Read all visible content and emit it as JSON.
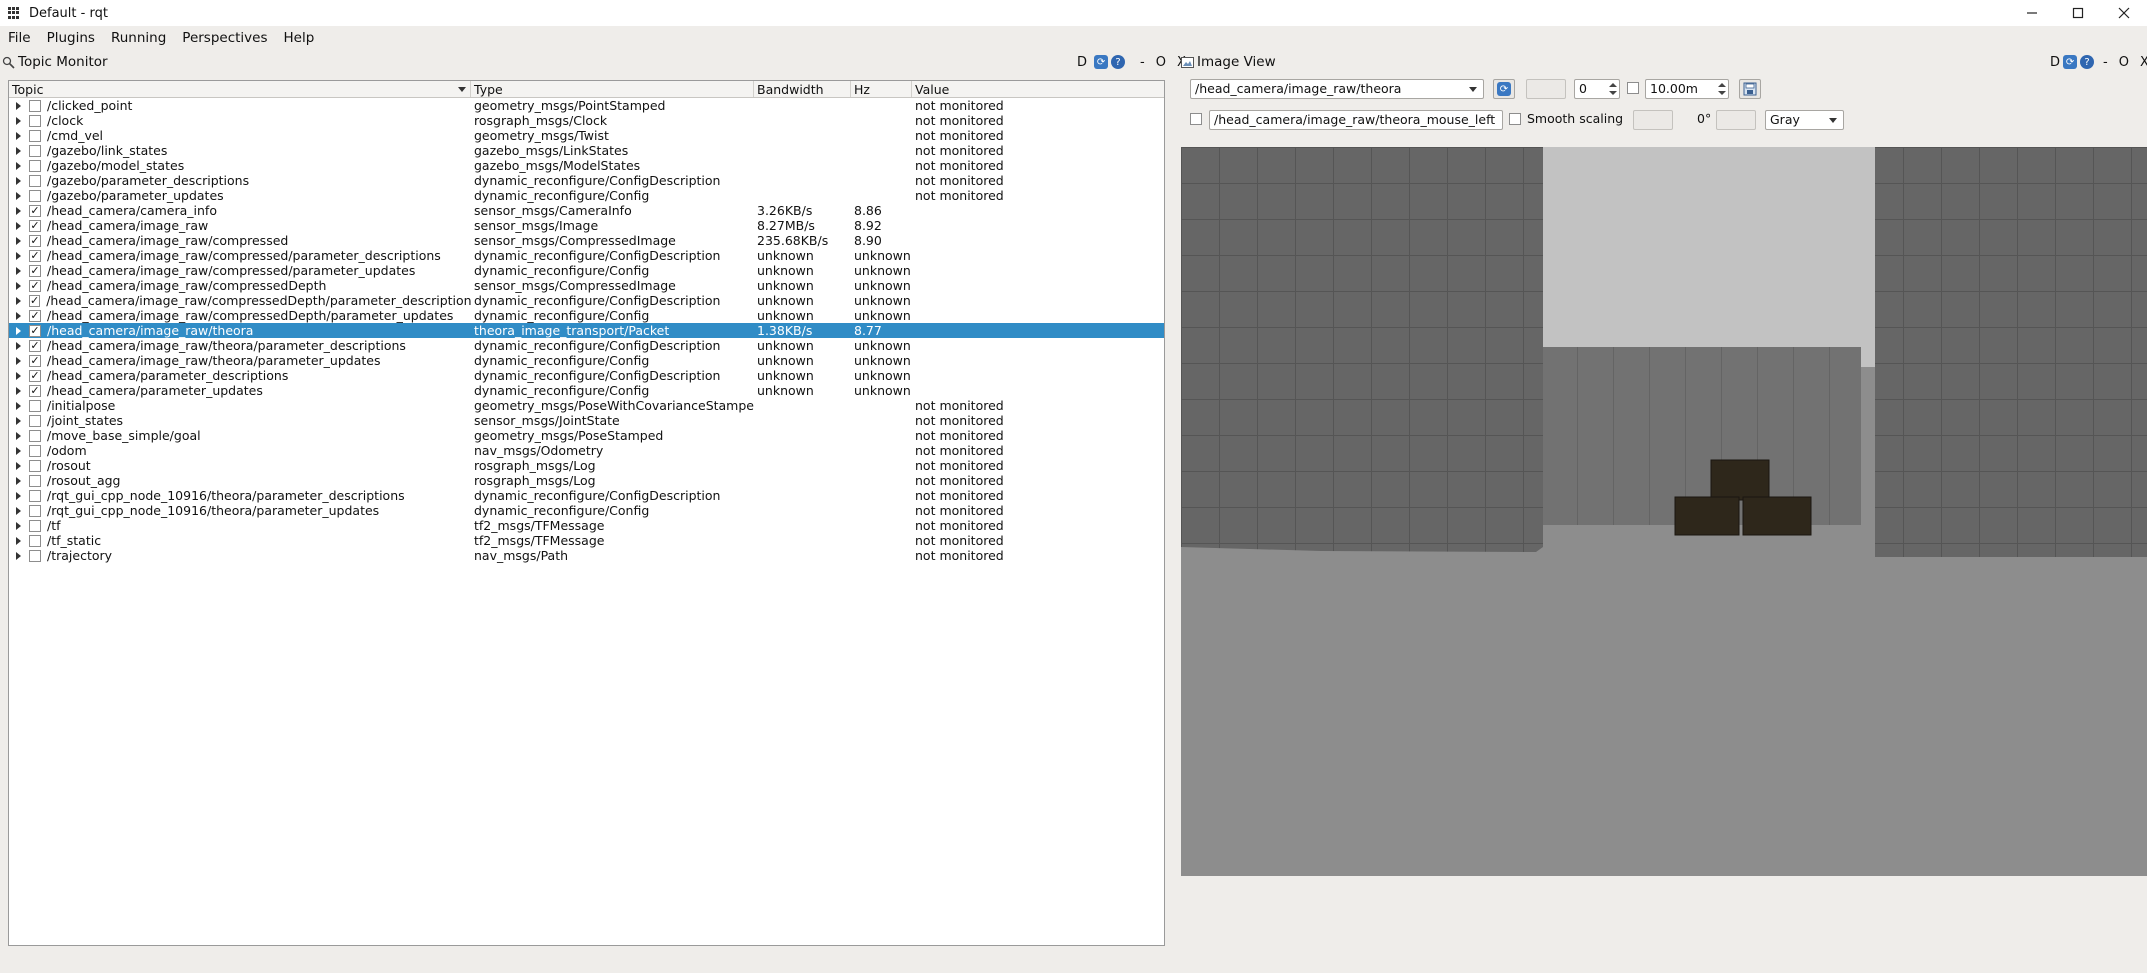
{
  "window": {
    "title": "Default - rqt"
  },
  "menu": [
    "File",
    "Plugins",
    "Running",
    "Perspectives",
    "Help"
  ],
  "topic_monitor": {
    "title": "Topic Monitor",
    "dock_buttons": [
      "D",
      "-",
      "O",
      "X"
    ],
    "columns": [
      "Topic",
      "Type",
      "Bandwidth",
      "Hz",
      "Value"
    ],
    "rows": [
      {
        "topic": "/clicked_point",
        "type": "geometry_msgs/PointStamped",
        "bw": "",
        "hz": "",
        "value": "not monitored",
        "checked": false
      },
      {
        "topic": "/clock",
        "type": "rosgraph_msgs/Clock",
        "bw": "",
        "hz": "",
        "value": "not monitored",
        "checked": false
      },
      {
        "topic": "/cmd_vel",
        "type": "geometry_msgs/Twist",
        "bw": "",
        "hz": "",
        "value": "not monitored",
        "checked": false
      },
      {
        "topic": "/gazebo/link_states",
        "type": "gazebo_msgs/LinkStates",
        "bw": "",
        "hz": "",
        "value": "not monitored",
        "checked": false
      },
      {
        "topic": "/gazebo/model_states",
        "type": "gazebo_msgs/ModelStates",
        "bw": "",
        "hz": "",
        "value": "not monitored",
        "checked": false
      },
      {
        "topic": "/gazebo/parameter_descriptions",
        "type": "dynamic_reconfigure/ConfigDescription",
        "bw": "",
        "hz": "",
        "value": "not monitored",
        "checked": false
      },
      {
        "topic": "/gazebo/parameter_updates",
        "type": "dynamic_reconfigure/Config",
        "bw": "",
        "hz": "",
        "value": "not monitored",
        "checked": false
      },
      {
        "topic": "/head_camera/camera_info",
        "type": "sensor_msgs/CameraInfo",
        "bw": "3.26KB/s",
        "hz": "8.86",
        "value": "",
        "checked": true
      },
      {
        "topic": "/head_camera/image_raw",
        "type": "sensor_msgs/Image",
        "bw": "8.27MB/s",
        "hz": "8.92",
        "value": "",
        "checked": true
      },
      {
        "topic": "/head_camera/image_raw/compressed",
        "type": "sensor_msgs/CompressedImage",
        "bw": "235.68KB/s",
        "hz": "8.90",
        "value": "",
        "checked": true
      },
      {
        "topic": "/head_camera/image_raw/compressed/parameter_descriptions",
        "type": "dynamic_reconfigure/ConfigDescription",
        "bw": "unknown",
        "hz": "unknown",
        "value": "",
        "checked": true
      },
      {
        "topic": "/head_camera/image_raw/compressed/parameter_updates",
        "type": "dynamic_reconfigure/Config",
        "bw": "unknown",
        "hz": "unknown",
        "value": "",
        "checked": true
      },
      {
        "topic": "/head_camera/image_raw/compressedDepth",
        "type": "sensor_msgs/CompressedImage",
        "bw": "unknown",
        "hz": "unknown",
        "value": "",
        "checked": true
      },
      {
        "topic": "/head_camera/image_raw/compressedDepth/parameter_descriptions",
        "type": "dynamic_reconfigure/ConfigDescription",
        "bw": "unknown",
        "hz": "unknown",
        "value": "",
        "checked": true
      },
      {
        "topic": "/head_camera/image_raw/compressedDepth/parameter_updates",
        "type": "dynamic_reconfigure/Config",
        "bw": "unknown",
        "hz": "unknown",
        "value": "",
        "checked": true
      },
      {
        "topic": "/head_camera/image_raw/theora",
        "type": "theora_image_transport/Packet",
        "bw": "1.38KB/s",
        "hz": "8.77",
        "value": "",
        "checked": true,
        "selected": true
      },
      {
        "topic": "/head_camera/image_raw/theora/parameter_descriptions",
        "type": "dynamic_reconfigure/ConfigDescription",
        "bw": "unknown",
        "hz": "unknown",
        "value": "",
        "checked": true
      },
      {
        "topic": "/head_camera/image_raw/theora/parameter_updates",
        "type": "dynamic_reconfigure/Config",
        "bw": "unknown",
        "hz": "unknown",
        "value": "",
        "checked": true
      },
      {
        "topic": "/head_camera/parameter_descriptions",
        "type": "dynamic_reconfigure/ConfigDescription",
        "bw": "unknown",
        "hz": "unknown",
        "value": "",
        "checked": true
      },
      {
        "topic": "/head_camera/parameter_updates",
        "type": "dynamic_reconfigure/Config",
        "bw": "unknown",
        "hz": "unknown",
        "value": "",
        "checked": true
      },
      {
        "topic": "/initialpose",
        "type": "geometry_msgs/PoseWithCovarianceStamped",
        "bw": "",
        "hz": "",
        "value": "not monitored",
        "checked": false
      },
      {
        "topic": "/joint_states",
        "type": "sensor_msgs/JointState",
        "bw": "",
        "hz": "",
        "value": "not monitored",
        "checked": false
      },
      {
        "topic": "/move_base_simple/goal",
        "type": "geometry_msgs/PoseStamped",
        "bw": "",
        "hz": "",
        "value": "not monitored",
        "checked": false
      },
      {
        "topic": "/odom",
        "type": "nav_msgs/Odometry",
        "bw": "",
        "hz": "",
        "value": "not monitored",
        "checked": false
      },
      {
        "topic": "/rosout",
        "type": "rosgraph_msgs/Log",
        "bw": "",
        "hz": "",
        "value": "not monitored",
        "checked": false
      },
      {
        "topic": "/rosout_agg",
        "type": "rosgraph_msgs/Log",
        "bw": "",
        "hz": "",
        "value": "not monitored",
        "checked": false
      },
      {
        "topic": "/rqt_gui_cpp_node_10916/theora/parameter_descriptions",
        "type": "dynamic_reconfigure/ConfigDescription",
        "bw": "",
        "hz": "",
        "value": "not monitored",
        "checked": false
      },
      {
        "topic": "/rqt_gui_cpp_node_10916/theora/parameter_updates",
        "type": "dynamic_reconfigure/Config",
        "bw": "",
        "hz": "",
        "value": "not monitored",
        "checked": false
      },
      {
        "topic": "/tf",
        "type": "tf2_msgs/TFMessage",
        "bw": "",
        "hz": "",
        "value": "not monitored",
        "checked": false
      },
      {
        "topic": "/tf_static",
        "type": "tf2_msgs/TFMessage",
        "bw": "",
        "hz": "",
        "value": "not monitored",
        "checked": false
      },
      {
        "topic": "/trajectory",
        "type": "nav_msgs/Path",
        "bw": "",
        "hz": "",
        "value": "not monitored",
        "checked": false
      }
    ]
  },
  "image_view": {
    "title": "Image View",
    "dock_buttons": [
      "D",
      "-",
      "O",
      "X"
    ],
    "topic_combo": "/head_camera/image_raw/theora",
    "spin_value": "0",
    "time_value": "10.00m",
    "mouse_topic": "/head_camera/image_raw/theora_mouse_left",
    "smooth_scaling_label": "Smooth scaling",
    "rotation": "0°",
    "color_scheme": "Gray"
  },
  "colors": {
    "selection": "#308cc6",
    "background": "#efedea"
  }
}
